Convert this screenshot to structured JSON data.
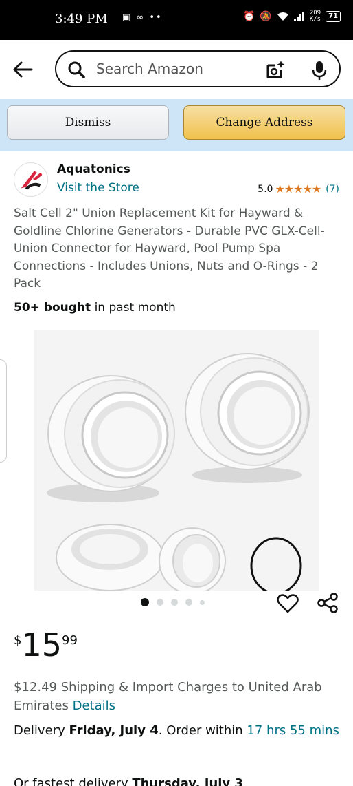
{
  "status_bar": {
    "time": "3:49 PM",
    "left_icons": "▣ ∞ ••",
    "speed_top": "209",
    "speed_bottom": "K/s",
    "battery": "71"
  },
  "search": {
    "placeholder": "Search Amazon"
  },
  "banner": {
    "dismiss_label": "Dismiss",
    "change_address_label": "Change Address"
  },
  "brand": {
    "name": "Aquatonics",
    "visit_store": "Visit the Store",
    "rating_value": "5.0",
    "rating_stars": 5,
    "rating_count": "(7)"
  },
  "product": {
    "title": "Salt Cell 2\" Union Replacement Kit for Hayward & Goldline Chlorine Generators - Durable PVC GLX-Cell-Union Connector for Hayward, Pool Pump Spa Connections - Includes Unions, Nuts and O-Rings - 2 Pack",
    "bought_bold": "50+ bought",
    "bought_rest": " in past month",
    "image_count": 5,
    "image_active_index": 0
  },
  "price": {
    "symbol": "$",
    "whole": "15",
    "fraction": "99"
  },
  "shipping": {
    "text": "$12.49 Shipping & Import Charges to United Arab Emirates ",
    "details_link": "Details"
  },
  "delivery": {
    "prefix": "Delivery ",
    "date": "Friday, July 4",
    "middle": ". Order within ",
    "countdown": "17 hrs 55 mins"
  },
  "fastest": {
    "prefix": "Or fastest delivery ",
    "date": "Thursday, July 3"
  },
  "colors": {
    "link": "#007185",
    "star": "#de7921",
    "banner_bg": "#cde5f7",
    "change_button": "#f0c14b"
  }
}
